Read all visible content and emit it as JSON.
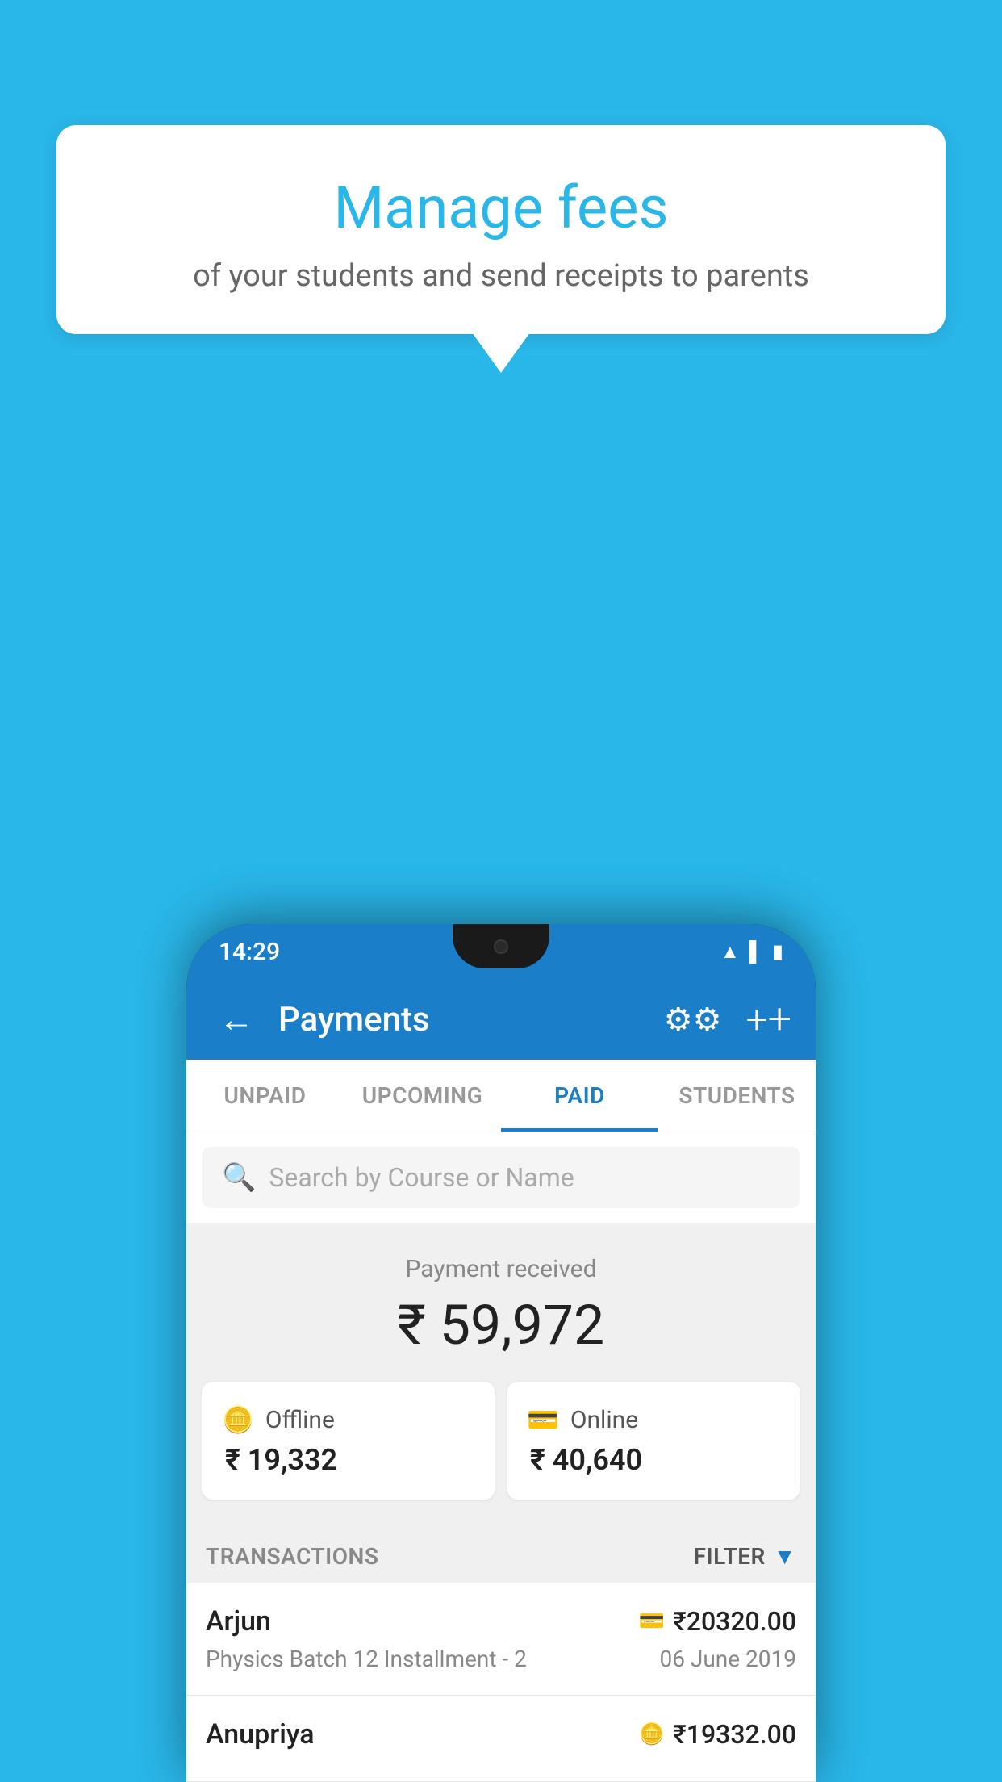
{
  "page": {
    "background_color": "#29b6e8"
  },
  "tooltip": {
    "title": "Manage fees",
    "subtitle": "of your students and send receipts to parents"
  },
  "status_bar": {
    "time": "14:29",
    "wifi": "wifi",
    "signal": "signal",
    "battery": "battery"
  },
  "header": {
    "back_label": "←",
    "title": "Payments",
    "gear_icon": "gear-icon",
    "plus_icon": "plus-icon"
  },
  "tabs": [
    {
      "label": "UNPAID",
      "active": false
    },
    {
      "label": "UPCOMING",
      "active": false
    },
    {
      "label": "PAID",
      "active": true
    },
    {
      "label": "STUDENTS",
      "active": false
    }
  ],
  "search": {
    "placeholder": "Search by Course or Name"
  },
  "payment_summary": {
    "label": "Payment received",
    "amount": "₹ 59,972"
  },
  "payment_cards": [
    {
      "type": "Offline",
      "icon": "offline-icon",
      "amount": "₹ 19,332"
    },
    {
      "type": "Online",
      "icon": "online-icon",
      "amount": "₹ 40,640"
    }
  ],
  "transactions_section": {
    "label": "TRANSACTIONS",
    "filter_label": "FILTER"
  },
  "transactions": [
    {
      "name": "Arjun",
      "course": "Physics Batch 12 Installment - 2",
      "amount": "₹20320.00",
      "date": "06 June 2019",
      "type_icon": "card-icon"
    },
    {
      "name": "Anupriya",
      "course": "",
      "amount": "₹19332.00",
      "date": "",
      "type_icon": "cash-icon"
    }
  ]
}
